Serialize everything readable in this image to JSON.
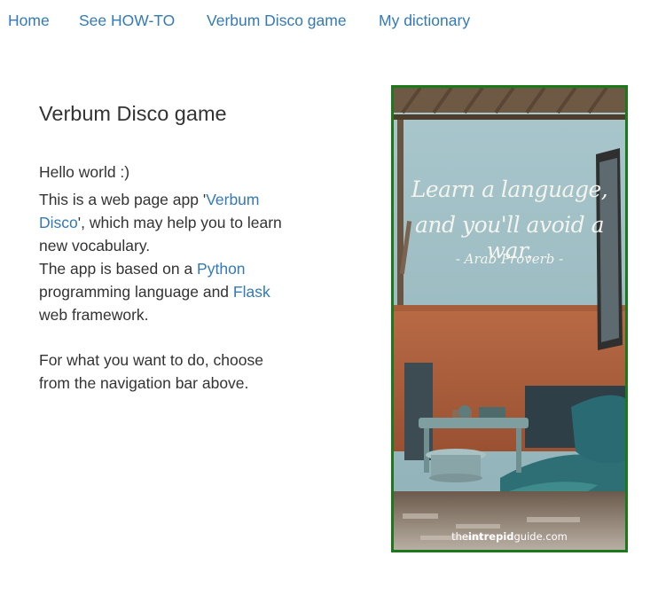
{
  "nav": {
    "items": [
      {
        "label": "Home"
      },
      {
        "label": "See HOW-TO"
      },
      {
        "label": "Verbum Disco game"
      },
      {
        "label": "My dictionary"
      }
    ]
  },
  "main": {
    "title": "Verbum Disco game",
    "hello": "Hello world :)",
    "intro": {
      "t1": "This is a web page app '",
      "link_app": "Verbum Disco",
      "t2": "', which may help you to learn new vocabulary.",
      "t3": "The app is based on a ",
      "link_python": "Python",
      "t4": " programming language and ",
      "link_flask": "Flask",
      "t5": " web framework."
    },
    "hint": "For what you want to do, choose from the navigation bar above."
  },
  "poster": {
    "quote_line1": "Learn a language,",
    "quote_line2": "and you'll avoid a war.",
    "attribution": "- Arab Proverb -",
    "brand_pre": "the",
    "brand_bold": "intrepid",
    "brand_post": "guide.com",
    "border_color": "#1a7a1a"
  }
}
